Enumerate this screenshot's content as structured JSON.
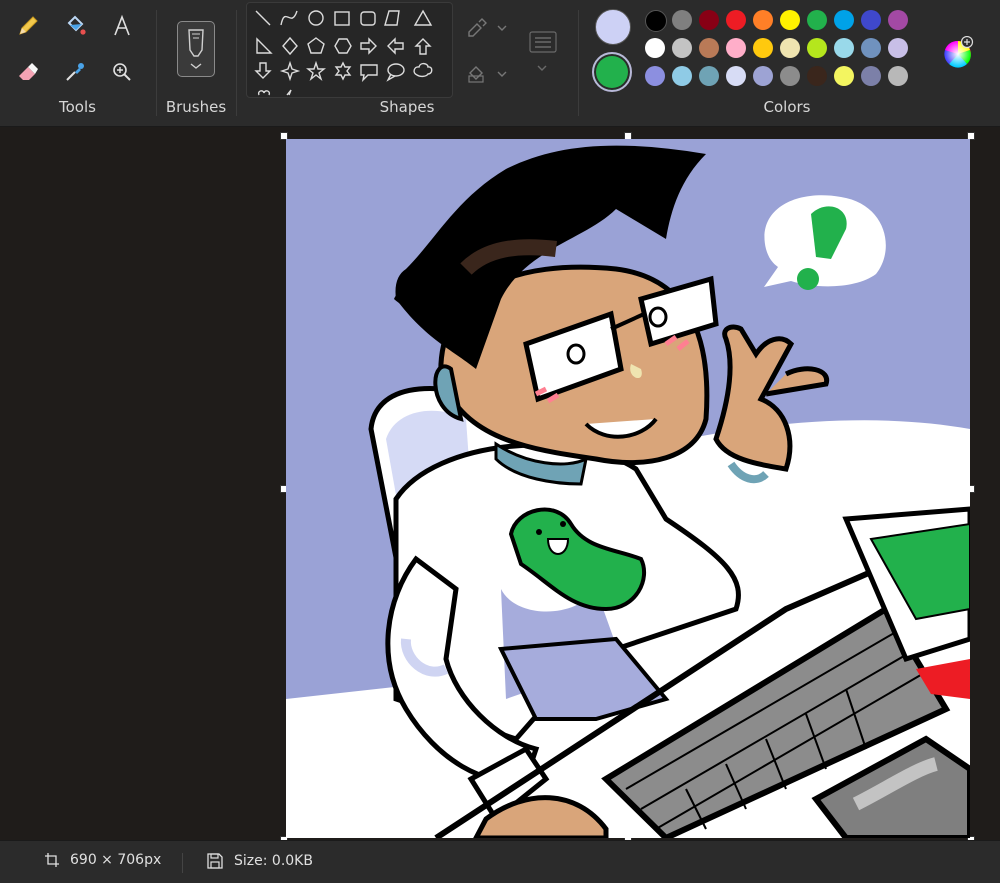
{
  "ribbon": {
    "groups": {
      "tools": "Tools",
      "brushes": "Brushes",
      "shapes": "Shapes",
      "colors": "Colors"
    },
    "tools": [
      "pencil-icon",
      "fill-icon",
      "text-icon",
      "eraser-icon",
      "color-picker-icon",
      "magnifier-icon"
    ],
    "shapes": [
      "line",
      "curve",
      "oval",
      "rectangle",
      "rounded-rectangle",
      "polygon",
      "triangle",
      "right-triangle",
      "diamond",
      "pentagon",
      "hexagon",
      "right-arrow",
      "left-arrow",
      "up-arrow",
      "down-arrow",
      "four-point-star",
      "five-point-star",
      "six-point-star",
      "rounded-callout",
      "oval-callout",
      "cloud-callout",
      "heart",
      "lightning"
    ],
    "primary_color": "#cdd1f5",
    "secondary_color": "#22b14c",
    "palette": [
      [
        "#000000",
        "#7f7f7f",
        "#880015",
        "#ed1c24",
        "#ff7f27",
        "#fff200",
        "#22b14c",
        "#00a2e8",
        "#3f48cc",
        "#a349a4"
      ],
      [
        "#ffffff",
        "#c3c3c3",
        "#b97a57",
        "#ffaec9",
        "#ffc90e",
        "#efe4b0",
        "#b5e61d",
        "#99d9ea",
        "#7092be",
        "#c8bfe7"
      ],
      [
        "#8c8fe0",
        "#8fcbe6",
        "#6fa3b5",
        "#d7dcf5",
        "#9da3d4",
        "#8c8c8c",
        "#3a261c",
        "#f3f560",
        "#7c80a8",
        "#b8b8b8"
      ]
    ]
  },
  "status": {
    "dimensions": "690 × 706px",
    "size": "Size: 0.0KB"
  }
}
